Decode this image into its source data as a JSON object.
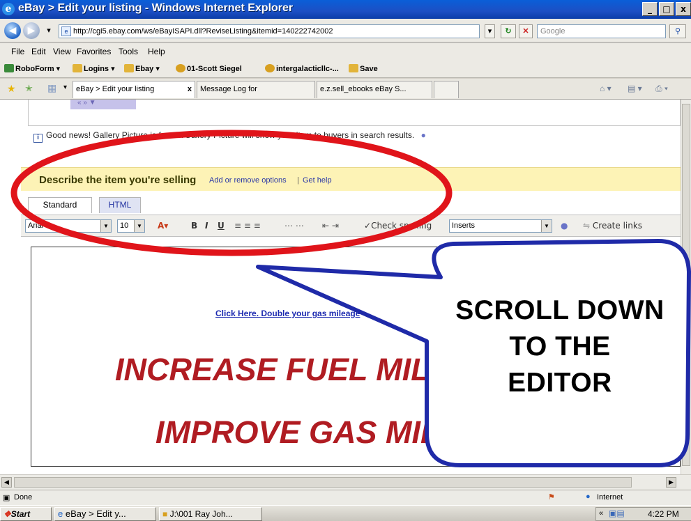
{
  "window": {
    "title": "eBay > Edit your listing - Windows Internet Explorer",
    "controls": [
      "_",
      "□",
      "x"
    ]
  },
  "address_bar": {
    "url": "http://cgi5.ebay.com/ws/eBayISAPI.dll?ReviseListing&itemid=140222742002",
    "search_placeholder": "Google"
  },
  "menu": [
    "File",
    "Edit",
    "View",
    "Favorites",
    "Tools",
    "Help"
  ],
  "links_bar": [
    "RoboForm",
    "Logins",
    "Ebay",
    "01-Scott Siegel",
    "intergalacticllc-...",
    "Save"
  ],
  "tabs": [
    {
      "label": "eBay > Edit your listing"
    },
    {
      "label": "Message Log for"
    },
    {
      "label": "e.z.sell_ebooks eBay S..."
    }
  ],
  "page": {
    "info_text": "Good news! Gallery Picture is free. A Gallery Picture will show your item to buyers in search results.",
    "section_title": "Describe the item you're selling",
    "section_links": [
      "Add or remove options",
      "Get help"
    ],
    "editor_tabs": [
      "Standard",
      "HTML"
    ],
    "toolbar": {
      "font": "Arial",
      "size": "10",
      "buttons": [
        "A",
        "B",
        "I",
        "U"
      ],
      "spell": "Check spelling",
      "inserts": "Inserts",
      "create_links": "Create links"
    },
    "editor_content": {
      "link": "Click Here. Double your gas mileage",
      "heading1": "INCREASE FUEL MILEAGE",
      "heading2": "IMPROVE GAS MILEAGE"
    }
  },
  "callout": {
    "lines": [
      "SCROLL DOWN",
      "TO THE",
      "EDITOR"
    ],
    "color": "#1f2aa8"
  },
  "annotation_ring_color": "#e0141a",
  "status_bar": {
    "left": "Done",
    "zone": "Internet"
  },
  "taskbar": {
    "start": "Start",
    "items": [
      "eBay > Edit y...",
      "J:\\001 Ray Joh..."
    ],
    "time": "4:22 PM"
  }
}
